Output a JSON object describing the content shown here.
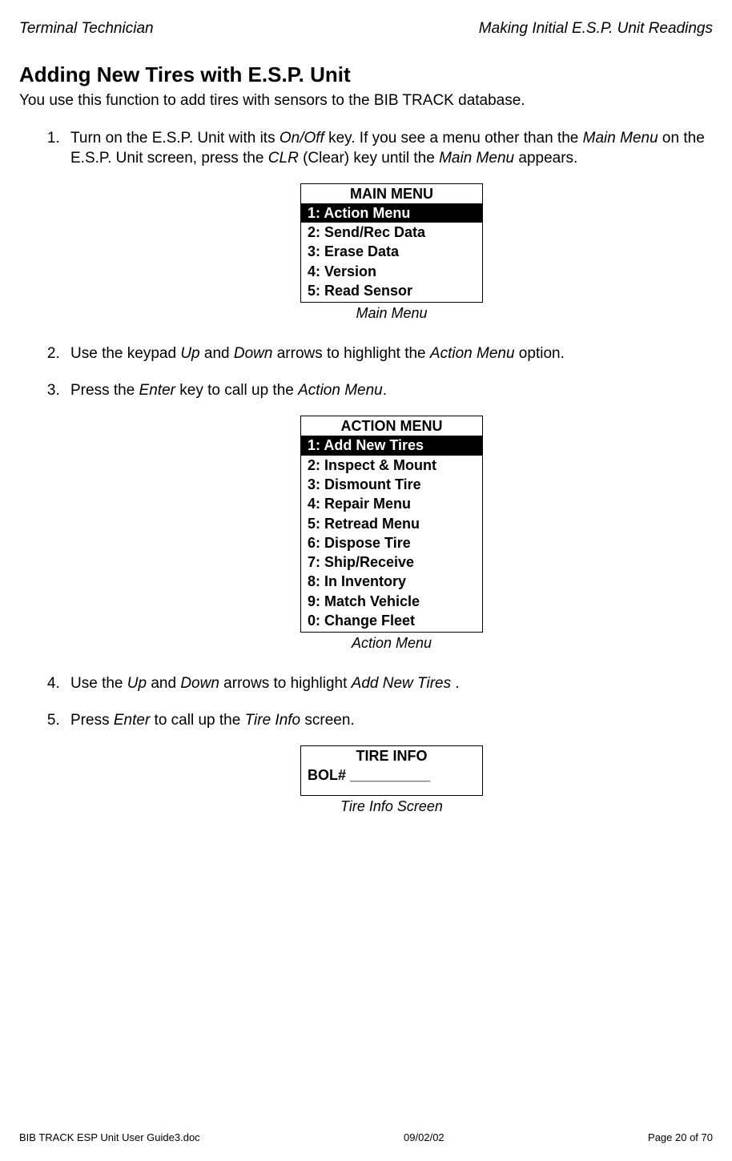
{
  "header": {
    "left": "Terminal Technician",
    "right": "Making Initial E.S.P. Unit Readings"
  },
  "section_title": "Adding New Tires with E.S.P. Unit",
  "intro": "You use this function to add tires with sensors to the BIB TRACK database.",
  "step1": {
    "pre": "Turn on the E.S.P. Unit with its ",
    "i1": "On/Off",
    "mid1": " key.  If you see a menu other than the ",
    "i2": "Main Menu",
    "mid2": " on the E.S.P. Unit screen, press the ",
    "i3": "CLR",
    "mid3": " (Clear) key until the ",
    "i4": "Main Menu",
    "post": " appears."
  },
  "main_menu": {
    "title": "MAIN MENU",
    "items": [
      "1: Action Menu",
      "2: Send/Rec Data",
      "3: Erase Data",
      "4: Version",
      "5: Read Sensor"
    ],
    "caption": "Main Menu"
  },
  "step2": {
    "pre": "Use the keypad ",
    "i1": "Up",
    "mid1": " and ",
    "i2": "Down",
    "mid2": " arrows to highlight the ",
    "i3": "Action Menu",
    "post": " option."
  },
  "step3": {
    "pre": "Press the ",
    "i1": "Enter",
    "mid1": " key to call up the ",
    "i2": "Action Menu",
    "post": "."
  },
  "action_menu": {
    "title": "ACTION MENU",
    "items": [
      "1: Add New Tires",
      "2: Inspect & Mount",
      "3: Dismount Tire",
      "4: Repair Menu",
      "5: Retread Menu",
      "6: Dispose Tire",
      "7: Ship/Receive",
      "8: In Inventory",
      "9: Match Vehicle",
      "0: Change Fleet"
    ],
    "caption": "Action Menu"
  },
  "step4": {
    "pre": "Use the ",
    "i1": "Up",
    "mid1": " and ",
    "i2": "Down",
    "mid2": " arrows to highlight ",
    "i3": "Add New Tires",
    "post": " ."
  },
  "step5": {
    "pre": "Press ",
    "i1": "Enter",
    "mid1": " to call up the ",
    "i2": "Tire Info",
    "post": " screen."
  },
  "tire_info": {
    "title": "TIRE INFO",
    "field": "BOL# __________",
    "caption": "Tire Info Screen"
  },
  "footer": {
    "left": "BIB TRACK  ESP Unit User Guide3.doc",
    "center": "09/02/02",
    "right": "Page 20 of 70"
  }
}
